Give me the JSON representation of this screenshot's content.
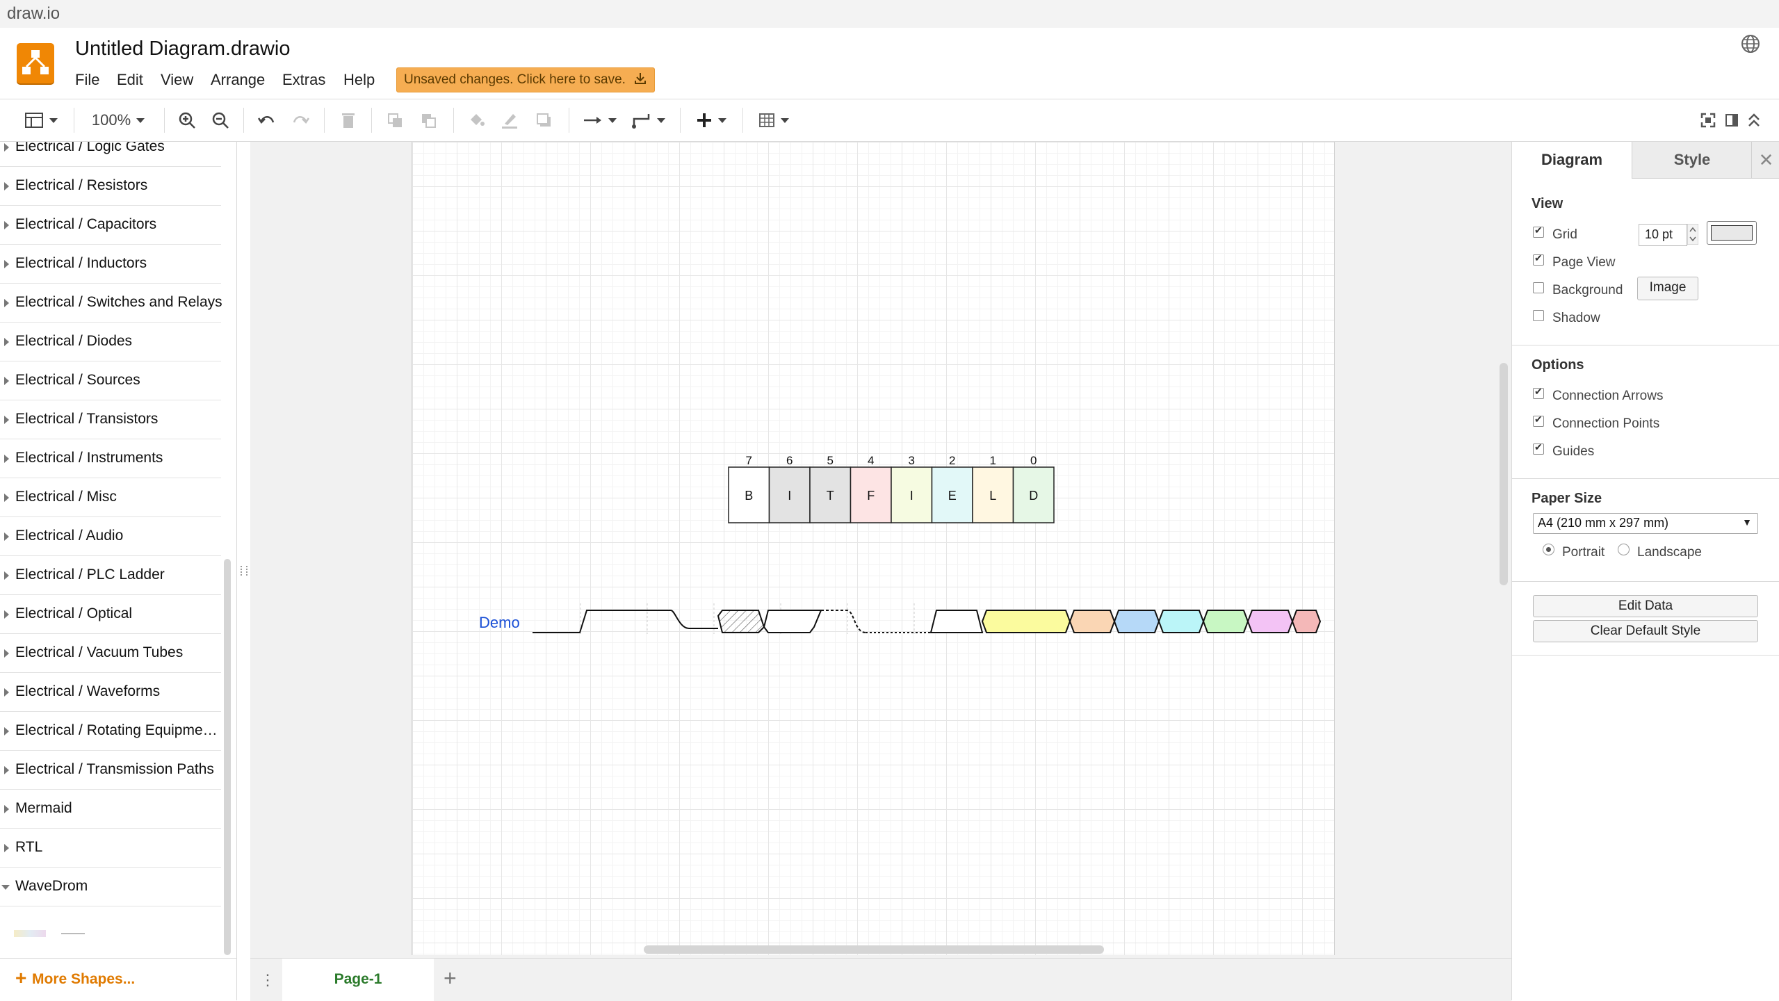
{
  "window": {
    "title": "draw.io"
  },
  "header": {
    "doc_title": "Untitled Diagram.drawio",
    "menu": [
      "File",
      "Edit",
      "View",
      "Arrange",
      "Extras",
      "Help"
    ],
    "unsaved_notice": "Unsaved changes. Click here to save."
  },
  "toolbar": {
    "zoom": "100%"
  },
  "sidebar": {
    "libraries": [
      {
        "label": "Electrical / Logic Gates",
        "expanded": false
      },
      {
        "label": "Electrical / Resistors",
        "expanded": false
      },
      {
        "label": "Electrical / Capacitors",
        "expanded": false
      },
      {
        "label": "Electrical / Inductors",
        "expanded": false
      },
      {
        "label": "Electrical / Switches and Relays",
        "expanded": false
      },
      {
        "label": "Electrical / Diodes",
        "expanded": false
      },
      {
        "label": "Electrical / Sources",
        "expanded": false
      },
      {
        "label": "Electrical / Transistors",
        "expanded": false
      },
      {
        "label": "Electrical / Instruments",
        "expanded": false
      },
      {
        "label": "Electrical / Misc",
        "expanded": false
      },
      {
        "label": "Electrical / Audio",
        "expanded": false
      },
      {
        "label": "Electrical / PLC Ladder",
        "expanded": false
      },
      {
        "label": "Electrical / Optical",
        "expanded": false
      },
      {
        "label": "Electrical / Vacuum Tubes",
        "expanded": false
      },
      {
        "label": "Electrical / Waveforms",
        "expanded": false
      },
      {
        "label": "Electrical / Rotating Equipme…",
        "expanded": false
      },
      {
        "label": "Electrical / Transmission Paths",
        "expanded": false
      },
      {
        "label": "Mermaid",
        "expanded": false
      },
      {
        "label": "RTL",
        "expanded": false
      },
      {
        "label": "WaveDrom",
        "expanded": true
      }
    ],
    "more_shapes": "More Shapes..."
  },
  "diagram": {
    "bitfield": {
      "bits": [
        {
          "index": "7",
          "char": "B",
          "color": "#ffffff"
        },
        {
          "index": "6",
          "char": "I",
          "color": "#e3e3e3"
        },
        {
          "index": "5",
          "char": "T",
          "color": "#e3e3e3"
        },
        {
          "index": "4",
          "char": "F",
          "color": "#fde4e4"
        },
        {
          "index": "3",
          "char": "I",
          "color": "#f6fbe1"
        },
        {
          "index": "2",
          "char": "E",
          "color": "#e2f8f8"
        },
        {
          "index": "1",
          "char": "L",
          "color": "#fff7e1"
        },
        {
          "index": "0",
          "char": "D",
          "color": "#e6f7e6"
        }
      ]
    },
    "wave": {
      "label": "Demo",
      "label_color": "#1a4fd6",
      "data_colors": [
        "#fbfb9e",
        "#fad6b4",
        "#b6d9f8",
        "#bbf5f8",
        "#c8f7c3",
        "#f3c3f5",
        "#f4b8b8"
      ]
    }
  },
  "pages": {
    "tabs": [
      "Page-1"
    ]
  },
  "format_panel": {
    "tabs": [
      "Diagram",
      "Style"
    ],
    "view": {
      "title": "View",
      "grid": {
        "label": "Grid",
        "checked": true,
        "size": "10 pt"
      },
      "page_view": {
        "label": "Page View",
        "checked": true
      },
      "background": {
        "label": "Background",
        "checked": false,
        "button": "Image"
      },
      "shadow": {
        "label": "Shadow",
        "checked": false
      }
    },
    "options": {
      "title": "Options",
      "connection_arrows": {
        "label": "Connection Arrows",
        "checked": true
      },
      "connection_points": {
        "label": "Connection Points",
        "checked": true
      },
      "guides": {
        "label": "Guides",
        "checked": true
      }
    },
    "paper": {
      "title": "Paper Size",
      "size": "A4 (210 mm x 297 mm)",
      "portrait": "Portrait",
      "landscape": "Landscape",
      "orientation": "portrait"
    },
    "buttons": {
      "edit_data": "Edit Data",
      "clear_style": "Clear Default Style"
    }
  }
}
